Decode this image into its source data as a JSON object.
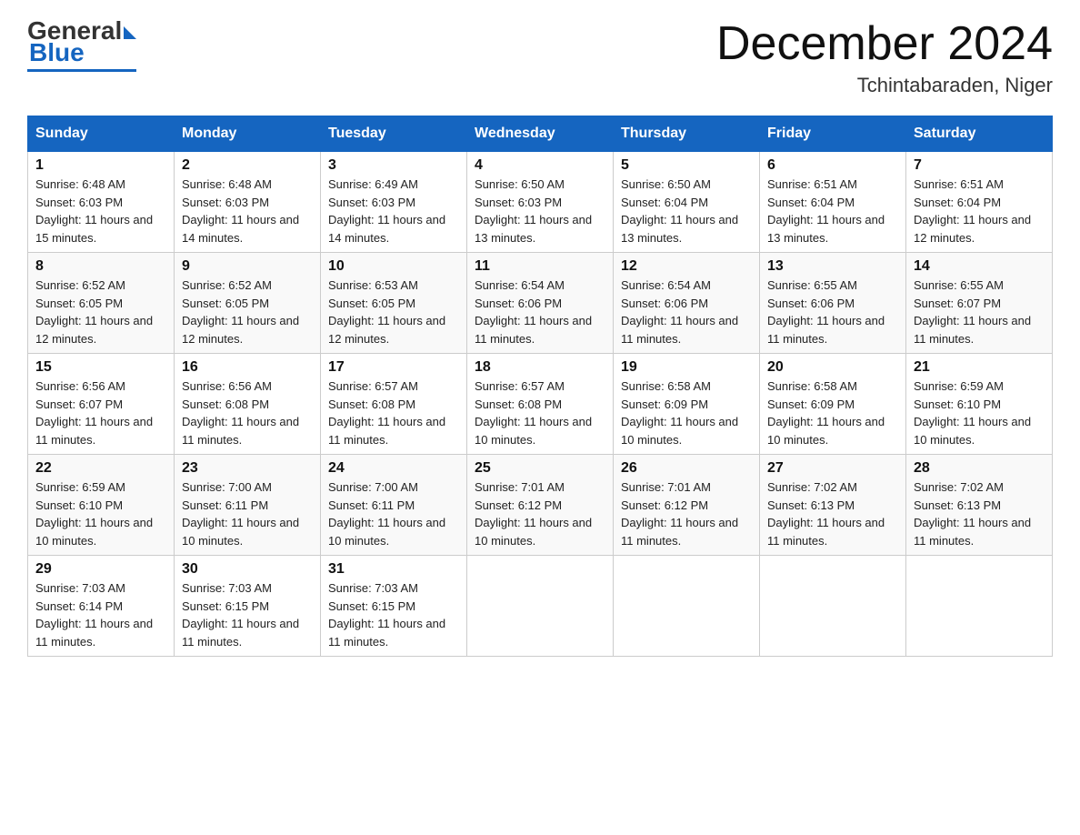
{
  "logo": {
    "general": "General",
    "blue": "Blue"
  },
  "title": "December 2024",
  "location": "Tchintabaraden, Niger",
  "days_header": [
    "Sunday",
    "Monday",
    "Tuesday",
    "Wednesday",
    "Thursday",
    "Friday",
    "Saturday"
  ],
  "weeks": [
    [
      {
        "day": "1",
        "sunrise": "6:48 AM",
        "sunset": "6:03 PM",
        "daylight": "11 hours and 15 minutes."
      },
      {
        "day": "2",
        "sunrise": "6:48 AM",
        "sunset": "6:03 PM",
        "daylight": "11 hours and 14 minutes."
      },
      {
        "day": "3",
        "sunrise": "6:49 AM",
        "sunset": "6:03 PM",
        "daylight": "11 hours and 14 minutes."
      },
      {
        "day": "4",
        "sunrise": "6:50 AM",
        "sunset": "6:03 PM",
        "daylight": "11 hours and 13 minutes."
      },
      {
        "day": "5",
        "sunrise": "6:50 AM",
        "sunset": "6:04 PM",
        "daylight": "11 hours and 13 minutes."
      },
      {
        "day": "6",
        "sunrise": "6:51 AM",
        "sunset": "6:04 PM",
        "daylight": "11 hours and 13 minutes."
      },
      {
        "day": "7",
        "sunrise": "6:51 AM",
        "sunset": "6:04 PM",
        "daylight": "11 hours and 12 minutes."
      }
    ],
    [
      {
        "day": "8",
        "sunrise": "6:52 AM",
        "sunset": "6:05 PM",
        "daylight": "11 hours and 12 minutes."
      },
      {
        "day": "9",
        "sunrise": "6:52 AM",
        "sunset": "6:05 PM",
        "daylight": "11 hours and 12 minutes."
      },
      {
        "day": "10",
        "sunrise": "6:53 AM",
        "sunset": "6:05 PM",
        "daylight": "11 hours and 12 minutes."
      },
      {
        "day": "11",
        "sunrise": "6:54 AM",
        "sunset": "6:06 PM",
        "daylight": "11 hours and 11 minutes."
      },
      {
        "day": "12",
        "sunrise": "6:54 AM",
        "sunset": "6:06 PM",
        "daylight": "11 hours and 11 minutes."
      },
      {
        "day": "13",
        "sunrise": "6:55 AM",
        "sunset": "6:06 PM",
        "daylight": "11 hours and 11 minutes."
      },
      {
        "day": "14",
        "sunrise": "6:55 AM",
        "sunset": "6:07 PM",
        "daylight": "11 hours and 11 minutes."
      }
    ],
    [
      {
        "day": "15",
        "sunrise": "6:56 AM",
        "sunset": "6:07 PM",
        "daylight": "11 hours and 11 minutes."
      },
      {
        "day": "16",
        "sunrise": "6:56 AM",
        "sunset": "6:08 PM",
        "daylight": "11 hours and 11 minutes."
      },
      {
        "day": "17",
        "sunrise": "6:57 AM",
        "sunset": "6:08 PM",
        "daylight": "11 hours and 11 minutes."
      },
      {
        "day": "18",
        "sunrise": "6:57 AM",
        "sunset": "6:08 PM",
        "daylight": "11 hours and 10 minutes."
      },
      {
        "day": "19",
        "sunrise": "6:58 AM",
        "sunset": "6:09 PM",
        "daylight": "11 hours and 10 minutes."
      },
      {
        "day": "20",
        "sunrise": "6:58 AM",
        "sunset": "6:09 PM",
        "daylight": "11 hours and 10 minutes."
      },
      {
        "day": "21",
        "sunrise": "6:59 AM",
        "sunset": "6:10 PM",
        "daylight": "11 hours and 10 minutes."
      }
    ],
    [
      {
        "day": "22",
        "sunrise": "6:59 AM",
        "sunset": "6:10 PM",
        "daylight": "11 hours and 10 minutes."
      },
      {
        "day": "23",
        "sunrise": "7:00 AM",
        "sunset": "6:11 PM",
        "daylight": "11 hours and 10 minutes."
      },
      {
        "day": "24",
        "sunrise": "7:00 AM",
        "sunset": "6:11 PM",
        "daylight": "11 hours and 10 minutes."
      },
      {
        "day": "25",
        "sunrise": "7:01 AM",
        "sunset": "6:12 PM",
        "daylight": "11 hours and 10 minutes."
      },
      {
        "day": "26",
        "sunrise": "7:01 AM",
        "sunset": "6:12 PM",
        "daylight": "11 hours and 11 minutes."
      },
      {
        "day": "27",
        "sunrise": "7:02 AM",
        "sunset": "6:13 PM",
        "daylight": "11 hours and 11 minutes."
      },
      {
        "day": "28",
        "sunrise": "7:02 AM",
        "sunset": "6:13 PM",
        "daylight": "11 hours and 11 minutes."
      }
    ],
    [
      {
        "day": "29",
        "sunrise": "7:03 AM",
        "sunset": "6:14 PM",
        "daylight": "11 hours and 11 minutes."
      },
      {
        "day": "30",
        "sunrise": "7:03 AM",
        "sunset": "6:15 PM",
        "daylight": "11 hours and 11 minutes."
      },
      {
        "day": "31",
        "sunrise": "7:03 AM",
        "sunset": "6:15 PM",
        "daylight": "11 hours and 11 minutes."
      },
      null,
      null,
      null,
      null
    ]
  ]
}
